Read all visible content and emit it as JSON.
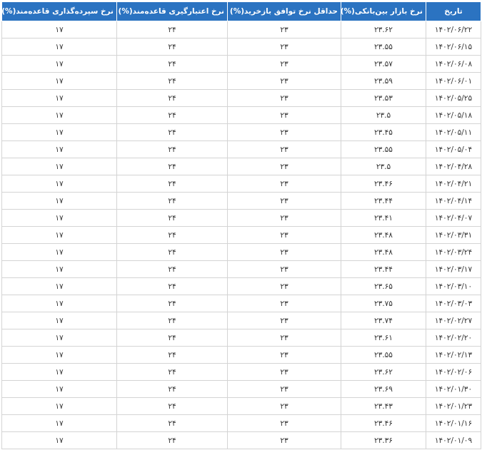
{
  "table": {
    "headers": [
      "تاریخ",
      "نرخ بازار بین‌بانکی(%)",
      "حداقل نرخ توافق بازخرید(%)",
      "نرخ اعتبارگیری قاعده‌مند(%)",
      "نرخ سپرده‌گذاری قاعده‌مند(%)"
    ],
    "rows": [
      [
        "۱۴۰۲/۰۶/۲۲",
        "۲۳.۶۲",
        "۲۳",
        "۲۴",
        "۱۷"
      ],
      [
        "۱۴۰۲/۰۶/۱۵",
        "۲۳.۵۵",
        "۲۳",
        "۲۴",
        "۱۷"
      ],
      [
        "۱۴۰۲/۰۶/۰۸",
        "۲۳.۵۷",
        "۲۳",
        "۲۴",
        "۱۷"
      ],
      [
        "۱۴۰۲/۰۶/۰۱",
        "۲۳.۵۹",
        "۲۳",
        "۲۴",
        "۱۷"
      ],
      [
        "۱۴۰۲/۰۵/۲۵",
        "۲۳.۵۳",
        "۲۳",
        "۲۴",
        "۱۷"
      ],
      [
        "۱۴۰۲/۰۵/۱۸",
        "۲۳.۵",
        "۲۳",
        "۲۴",
        "۱۷"
      ],
      [
        "۱۴۰۲/۰۵/۱۱",
        "۲۳.۴۵",
        "۲۳",
        "۲۴",
        "۱۷"
      ],
      [
        "۱۴۰۲/۰۵/۰۴",
        "۲۳.۵۵",
        "۲۳",
        "۲۴",
        "۱۷"
      ],
      [
        "۱۴۰۲/۰۴/۲۸",
        "۲۳.۵",
        "۲۳",
        "۲۴",
        "۱۷"
      ],
      [
        "۱۴۰۲/۰۴/۲۱",
        "۲۳.۴۶",
        "۲۳",
        "۲۴",
        "۱۷"
      ],
      [
        "۱۴۰۲/۰۴/۱۴",
        "۲۳.۴۴",
        "۲۳",
        "۲۴",
        "۱۷"
      ],
      [
        "۱۴۰۲/۰۴/۰۷",
        "۲۳.۴۱",
        "۲۳",
        "۲۴",
        "۱۷"
      ],
      [
        "۱۴۰۲/۰۳/۳۱",
        "۲۳.۴۸",
        "۲۳",
        "۲۴",
        "۱۷"
      ],
      [
        "۱۴۰۲/۰۳/۲۴",
        "۲۳.۴۸",
        "۲۳",
        "۲۴",
        "۱۷"
      ],
      [
        "۱۴۰۲/۰۳/۱۷",
        "۲۳.۴۴",
        "۲۳",
        "۲۴",
        "۱۷"
      ],
      [
        "۱۴۰۲/۰۳/۱۰",
        "۲۳.۶۵",
        "۲۳",
        "۲۴",
        "۱۷"
      ],
      [
        "۱۴۰۲/۰۳/۰۳",
        "۲۳.۷۵",
        "۲۳",
        "۲۴",
        "۱۷"
      ],
      [
        "۱۴۰۲/۰۲/۲۷",
        "۲۳.۷۴",
        "۲۳",
        "۲۴",
        "۱۷"
      ],
      [
        "۱۴۰۲/۰۲/۲۰",
        "۲۳.۶۱",
        "۲۳",
        "۲۴",
        "۱۷"
      ],
      [
        "۱۴۰۲/۰۲/۱۳",
        "۲۳.۵۵",
        "۲۳",
        "۲۴",
        "۱۷"
      ],
      [
        "۱۴۰۲/۰۲/۰۶",
        "۲۳.۶۲",
        "۲۳",
        "۲۴",
        "۱۷"
      ],
      [
        "۱۴۰۲/۰۱/۳۰",
        "۲۳.۶۹",
        "۲۳",
        "۲۴",
        "۱۷"
      ],
      [
        "۱۴۰۲/۰۱/۲۳",
        "۲۳.۴۳",
        "۲۳",
        "۲۴",
        "۱۷"
      ],
      [
        "۱۴۰۲/۰۱/۱۶",
        "۲۳.۴۶",
        "۲۳",
        "۲۴",
        "۱۷"
      ],
      [
        "۱۴۰۲/۰۱/۰۹",
        "۲۳.۳۶",
        "۲۳",
        "۲۴",
        "۱۷"
      ]
    ]
  },
  "colors": {
    "header_background": "#2b73c1",
    "header_text": "#ffffff",
    "cell_border": "#d4d4d4",
    "cell_text": "#333333"
  }
}
